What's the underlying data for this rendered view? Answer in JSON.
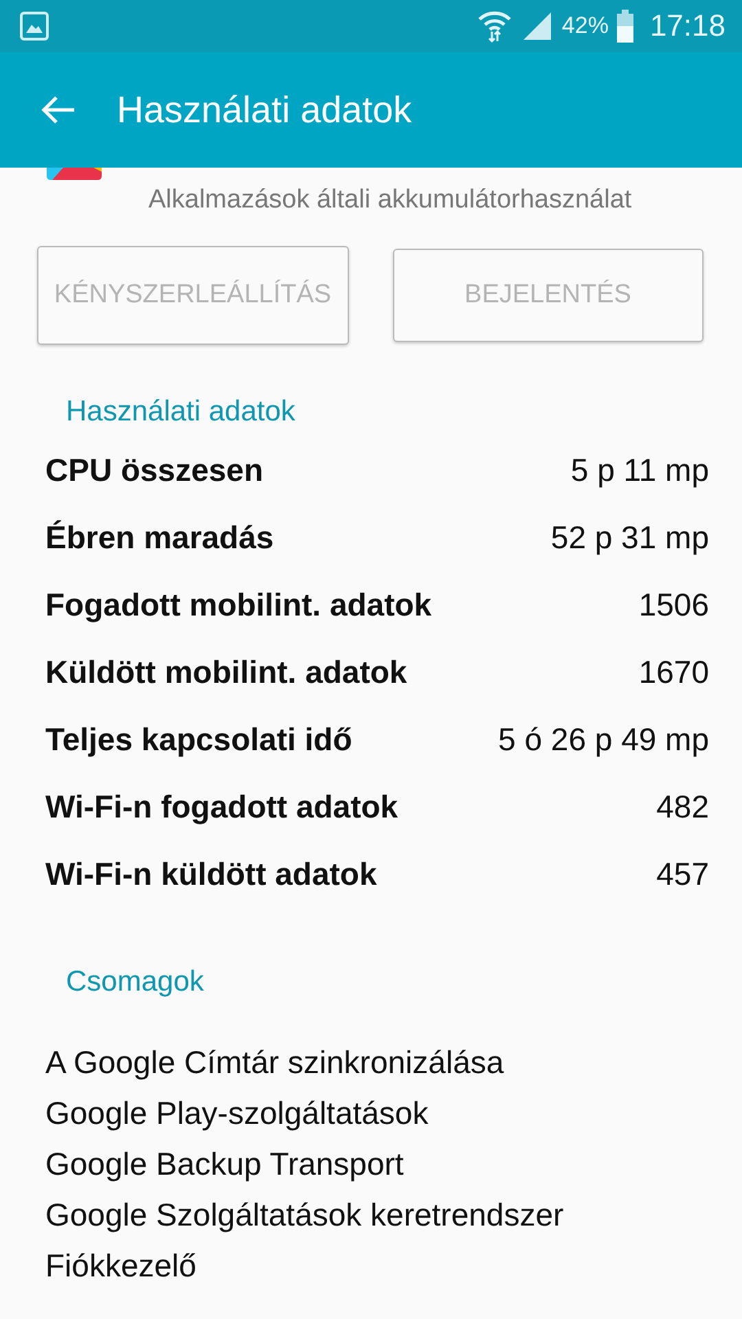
{
  "status_bar": {
    "battery_text": "42%",
    "time": "17:18"
  },
  "app_bar": {
    "title": "Használati adatok"
  },
  "app": {
    "subtitle": "Alkalmazások általi akkumulátorhasználat"
  },
  "buttons": [
    {
      "label": "KÉNYSZERLEÁLLÍTÁS",
      "disabled": true
    },
    {
      "label": "BEJELENTÉS",
      "disabled": true
    }
  ],
  "usage": {
    "header": "Használati adatok",
    "rows": [
      {
        "label": "CPU összesen",
        "value": "5 p 11 mp"
      },
      {
        "label": "Ébren maradás",
        "value": "52 p 31 mp"
      },
      {
        "label": "Fogadott mobilint. adatok",
        "value": "1506"
      },
      {
        "label": "Küldött mobilint. adatok",
        "value": "1670"
      },
      {
        "label": "Teljes kapcsolati idő",
        "value": "5 ó 26 p 49 mp"
      },
      {
        "label": "Wi-Fi-n fogadott adatok",
        "value": "482"
      },
      {
        "label": "Wi-Fi-n küldött adatok",
        "value": "457"
      }
    ]
  },
  "packages": {
    "header": "Csomagok",
    "items": [
      "A Google Címtár szinkronizálása",
      "Google Play-szolgáltatások",
      "Google Backup Transport",
      "Google Szolgáltatások keretrendszer",
      "Fiókkezelő"
    ]
  }
}
